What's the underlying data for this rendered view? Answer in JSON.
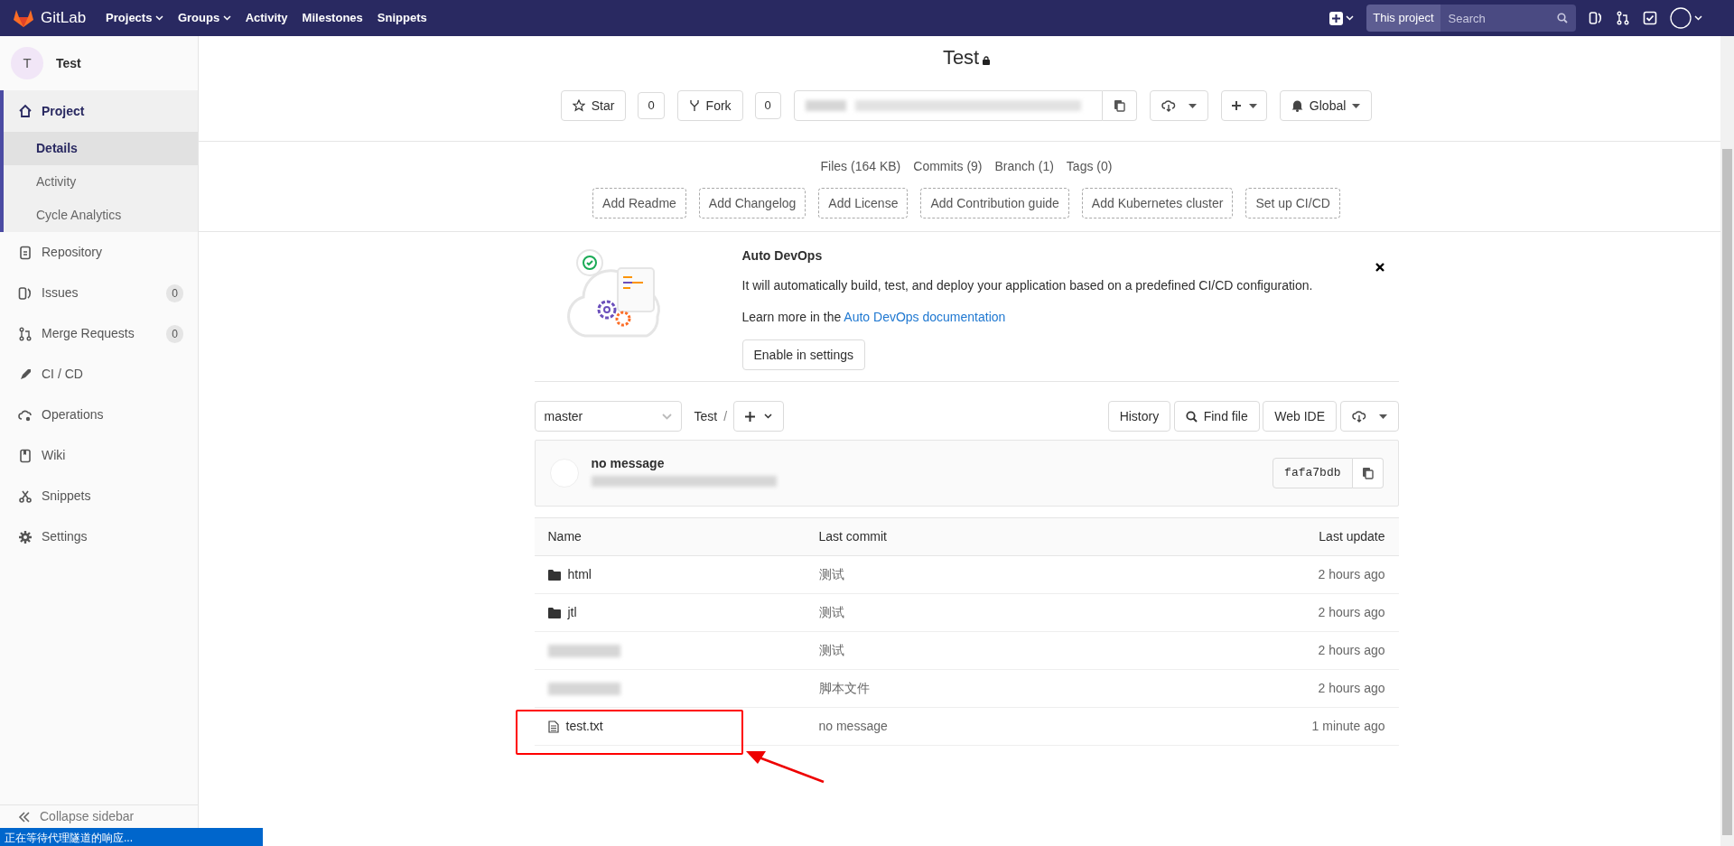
{
  "navbar": {
    "logo_text": "GitLab",
    "links": [
      {
        "label": "Projects",
        "dropdown": true
      },
      {
        "label": "Groups",
        "dropdown": true
      },
      {
        "label": "Activity",
        "dropdown": false
      },
      {
        "label": "Milestones",
        "dropdown": false
      },
      {
        "label": "Snippets",
        "dropdown": false
      }
    ],
    "search": {
      "scope": "This project",
      "placeholder": "Search"
    }
  },
  "sidebar": {
    "project": {
      "avatar_letter": "T",
      "name": "Test"
    },
    "items": [
      {
        "label": "Project",
        "selected": true,
        "children": [
          {
            "label": "Details",
            "selected": true
          },
          {
            "label": "Activity",
            "selected": false
          },
          {
            "label": "Cycle Analytics",
            "selected": false
          }
        ]
      },
      {
        "label": "Repository",
        "selected": false
      },
      {
        "label": "Issues",
        "selected": false,
        "count": "0"
      },
      {
        "label": "Merge Requests",
        "selected": false,
        "count": "0"
      },
      {
        "label": "CI / CD",
        "selected": false
      },
      {
        "label": "Operations",
        "selected": false
      },
      {
        "label": "Wiki",
        "selected": false
      },
      {
        "label": "Snippets",
        "selected": false
      },
      {
        "label": "Settings",
        "selected": false
      }
    ],
    "collapse": "Collapse sidebar"
  },
  "project": {
    "title": "Test",
    "star": {
      "label": "Star",
      "count": "0"
    },
    "fork": {
      "label": "Fork",
      "count": "0"
    },
    "notification": "Global",
    "stats": [
      "Files (164 KB)",
      "Commits (9)",
      "Branch (1)",
      "Tags (0)"
    ],
    "quick_actions": [
      "Add Readme",
      "Add Changelog",
      "Add License",
      "Add Contribution guide",
      "Add Kubernetes cluster",
      "Set up CI/CD"
    ]
  },
  "devops": {
    "title": "Auto DevOps",
    "text": "It will automatically build, test, and deploy your application based on a predefined CI/CD configuration.",
    "learn_prefix": "Learn more in the ",
    "link": "Auto DevOps documentation",
    "button": "Enable in settings"
  },
  "toolbar": {
    "branch": "master",
    "path": "Test",
    "separator": "/",
    "buttons": [
      "History",
      "Find file",
      "Web IDE"
    ]
  },
  "commit": {
    "message": "no message",
    "sha": "fafa7bdb"
  },
  "table": {
    "columns": [
      "Name",
      "Last commit",
      "Last update"
    ],
    "rows": [
      {
        "kind": "folder",
        "name": "html",
        "commit": "测试",
        "updated": "2 hours ago",
        "annotated": false
      },
      {
        "kind": "folder",
        "name": "jtl",
        "commit": "测试",
        "updated": "2 hours ago",
        "annotated": false
      },
      {
        "kind": "redacted",
        "commit": "测试",
        "updated": "2 hours ago",
        "annotated": false
      },
      {
        "kind": "redacted",
        "commit": "脚本文件",
        "updated": "2 hours ago",
        "annotated": false
      },
      {
        "kind": "file",
        "name": "test.txt",
        "commit": "no message",
        "updated": "1 minute ago",
        "annotated": true
      }
    ]
  },
  "status_bar": "正在等待代理隧道的响应..."
}
